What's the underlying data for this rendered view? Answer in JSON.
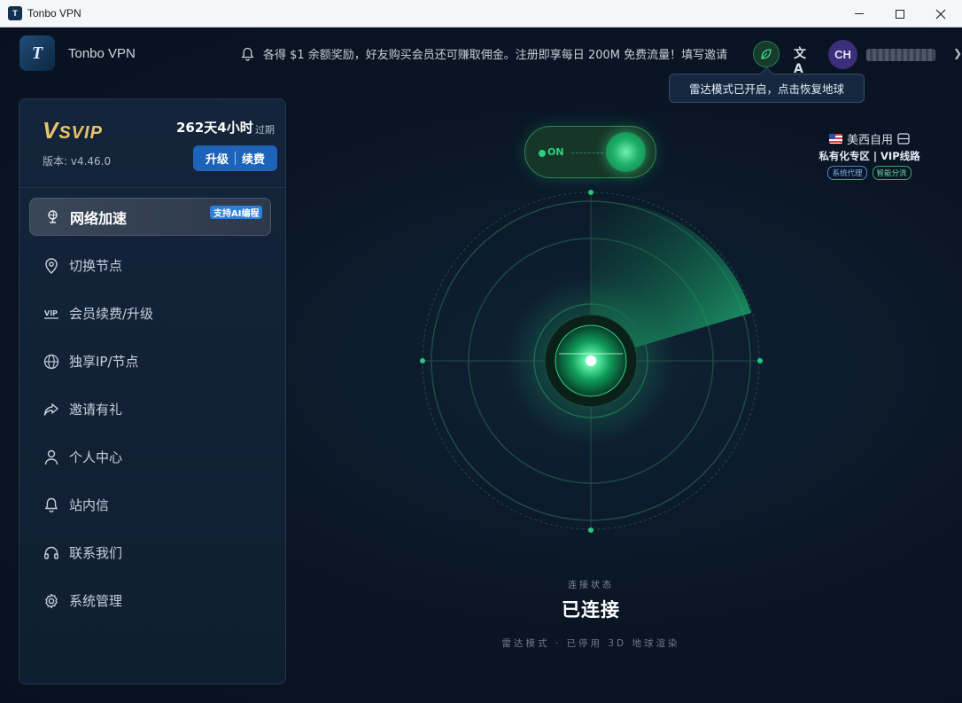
{
  "window": {
    "title": "Tonbo VPN",
    "logo_text": "T"
  },
  "header": {
    "app_name": "Tonbo VPN",
    "logo_text": "T",
    "notice": "各得 $1 余额奖励，好友购买会员还可赚取佣金。注册即享每日 200M 免费流量！填写邀请",
    "lang_icon_text": "文A",
    "avatar_initials": "CH",
    "tooltip": "雷达模式已开启，点击恢复地球"
  },
  "sidebar": {
    "vip": {
      "badge": "SVIP",
      "badge_prefix": "V",
      "remaining": "262天4小时",
      "expire_suffix": "过期",
      "version": "版本: v4.46.0",
      "upgrade_label": "升级",
      "renew_label": "续费"
    },
    "items": [
      {
        "label": "网络加速",
        "icon": "globe-pin-icon",
        "active": true,
        "badge": "支持AI编程"
      },
      {
        "label": "切换节点",
        "icon": "location-pin-icon"
      },
      {
        "label": "会员续费/升级",
        "icon": "vip-icon"
      },
      {
        "label": "独享IP/节点",
        "icon": "globe-icon"
      },
      {
        "label": "邀请有礼",
        "icon": "share-icon"
      },
      {
        "label": "个人中心",
        "icon": "user-icon"
      },
      {
        "label": "站内信",
        "icon": "bell-icon"
      },
      {
        "label": "联系我们",
        "icon": "headset-icon"
      },
      {
        "label": "系统管理",
        "icon": "gear-icon"
      }
    ]
  },
  "main": {
    "toggle": {
      "label": "ON",
      "state": "on"
    },
    "node": {
      "name": "美西自用",
      "subtitle": "私有化专区 | VIP线路",
      "tag_system_proxy": "系统代理",
      "tag_smart_split": "智能分流"
    },
    "status_label": "连接状态",
    "status_value": "已连接",
    "mode_text": "雷达模式 · 已停用 3D 地球渲染"
  },
  "colors": {
    "accent_green": "#27d07c",
    "accent_blue": "#1d63b9",
    "vip_gold": "#e8c36a",
    "background": "#0a1524"
  }
}
